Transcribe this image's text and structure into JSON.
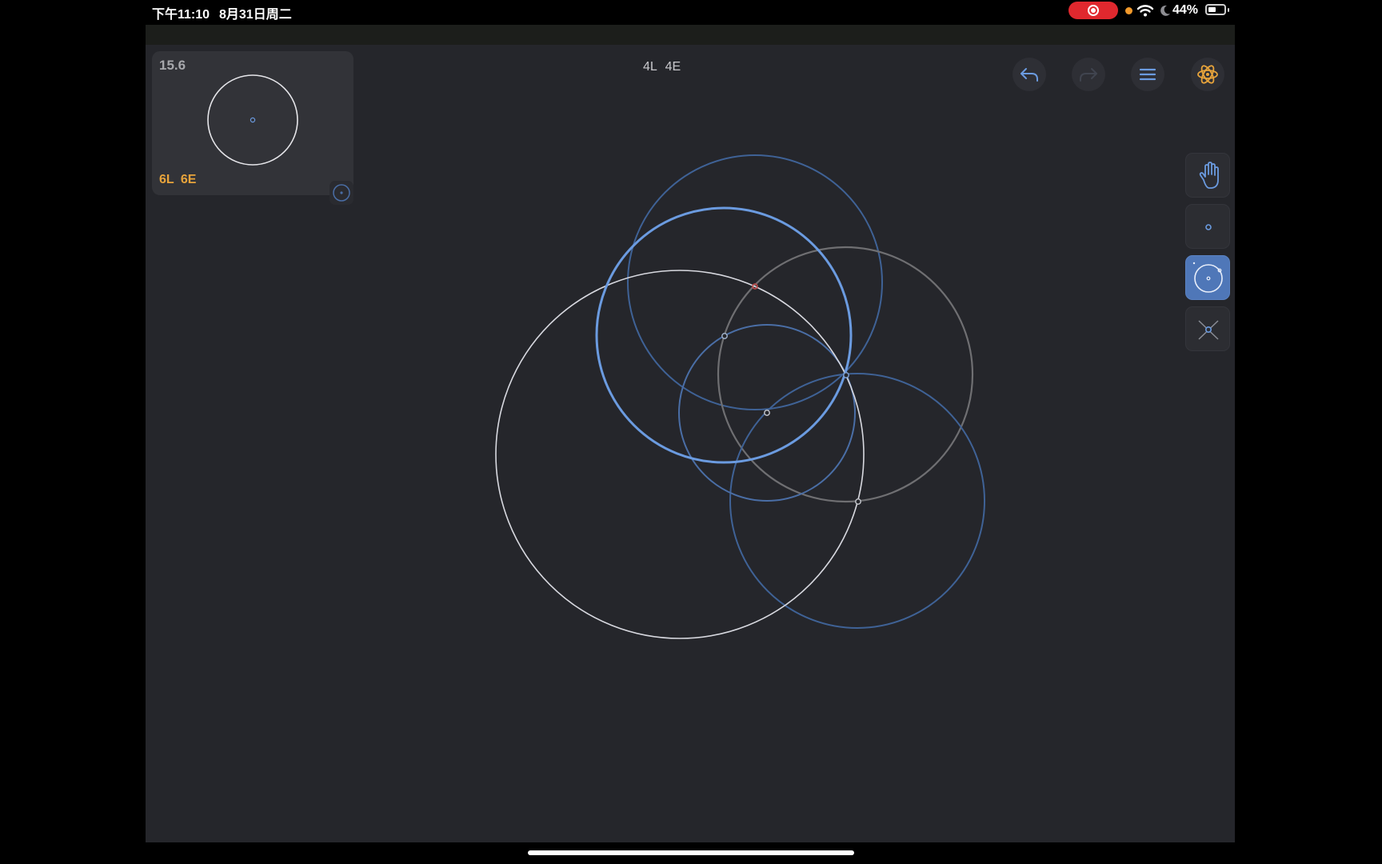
{
  "status_bar": {
    "time": "下午11:10",
    "date": "8月31日周二",
    "battery": "44%"
  },
  "level_card": {
    "score": "15.6",
    "goal": "6L 6E"
  },
  "moves": "4L 4E",
  "colors": {
    "background": "#25262b",
    "accent_blue": "#4f77b8",
    "goal_orange": "#e8a43b",
    "recording_red": "#e0282e"
  },
  "toolbar": {
    "undo": "undo-icon",
    "redo": "redo-icon",
    "menu": "menu-icon",
    "hint": "atom-icon"
  },
  "tools": {
    "items": [
      "hand-icon",
      "point-icon",
      "circle-icon",
      "intersect-icon"
    ],
    "active": "circle-icon"
  }
}
